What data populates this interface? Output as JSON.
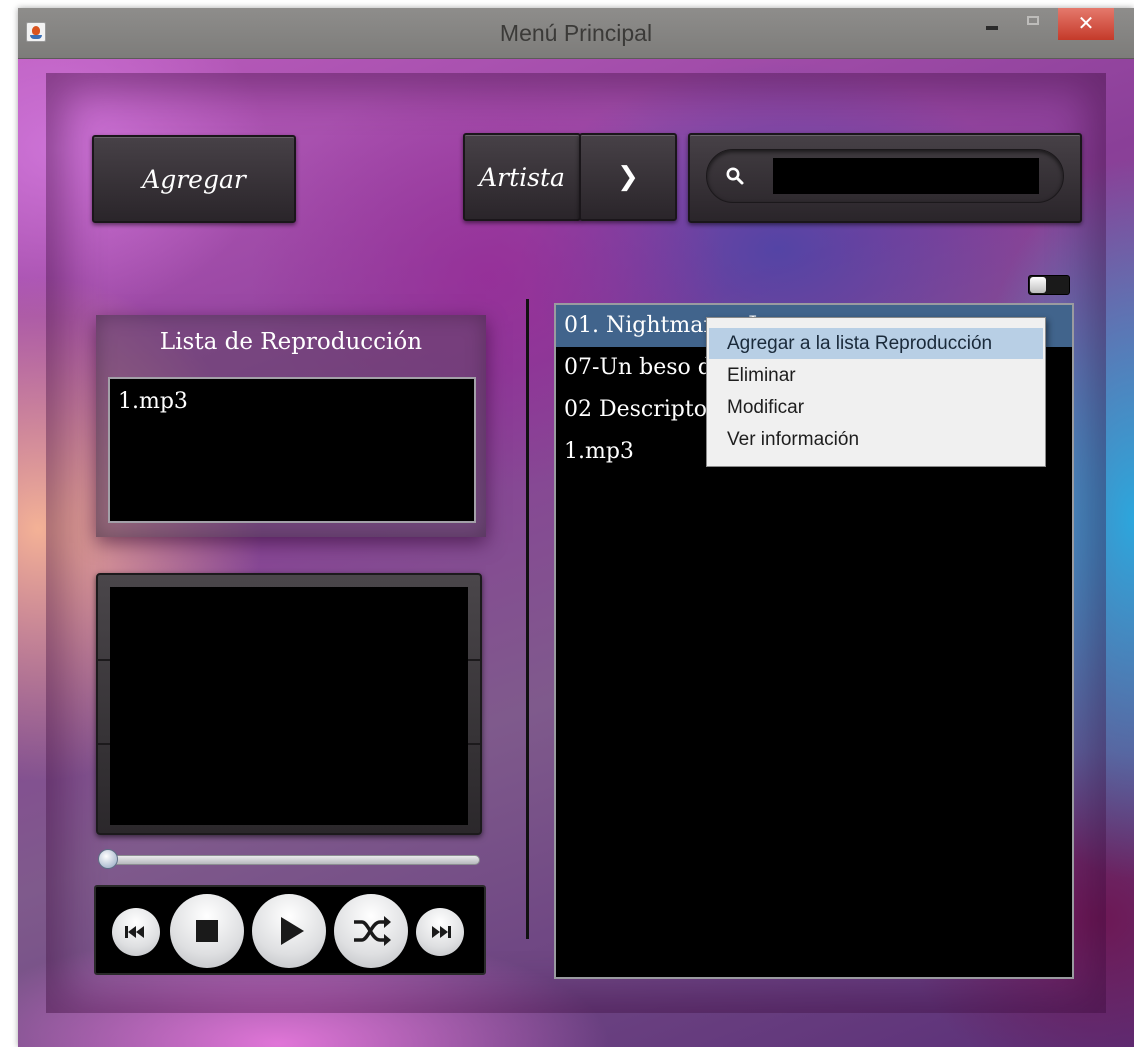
{
  "window": {
    "title": "Menú Principal",
    "close_glyph": "✕"
  },
  "toolbar": {
    "add_label": "Agregar",
    "filter_label": "Artista",
    "next_glyph": "❯",
    "search": {
      "value": "",
      "placeholder": ""
    }
  },
  "playlist": {
    "title": "Lista de Reproducción",
    "items": [
      "1.mp3"
    ]
  },
  "player": {
    "progress": 0.0,
    "buttons": [
      {
        "name": "previous-track-icon"
      },
      {
        "name": "stop-icon"
      },
      {
        "name": "play-icon"
      },
      {
        "name": "shuffle-icon"
      },
      {
        "name": "next-track-icon"
      }
    ]
  },
  "library": {
    "songs": [
      {
        "label": "01. Nightmare - Ja"
      },
      {
        "label": "07-Un beso d"
      },
      {
        "label": "02 Descripto"
      },
      {
        "label": "1.mp3"
      }
    ],
    "selected_index": 0
  },
  "context_menu": {
    "items": [
      {
        "label": "Agregar a la lista Reproducción"
      },
      {
        "label": "Eliminar"
      },
      {
        "label": "Modificar"
      },
      {
        "label": "Ver información"
      }
    ],
    "highlighted_index": 0
  },
  "colors": {
    "selection": "#41648c",
    "menu_highlight": "#b8cfe5",
    "close_button": "#c43a2a"
  }
}
